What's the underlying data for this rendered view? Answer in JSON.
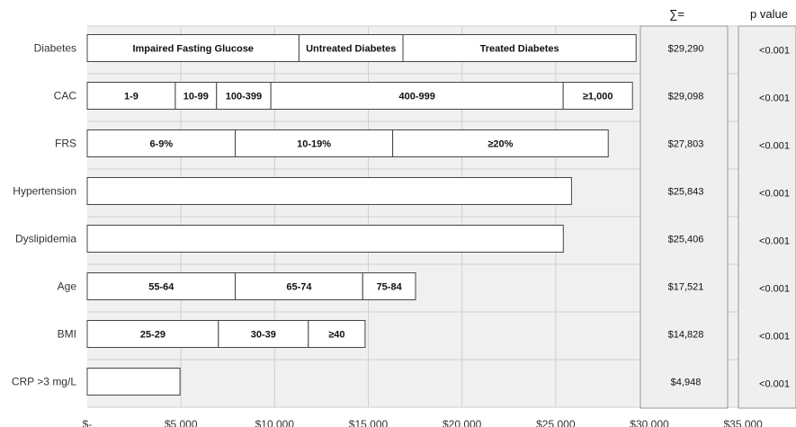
{
  "chart_data": {
    "type": "bar",
    "orientation": "horizontal",
    "stacked_segments": true,
    "xlim": [
      0,
      35000
    ],
    "grid": true,
    "x_ticks": [
      {
        "value": 0,
        "label": "$-"
      },
      {
        "value": 5000,
        "label": "$5,000"
      },
      {
        "value": 10000,
        "label": "$10,000"
      },
      {
        "value": 15000,
        "label": "$15,000"
      },
      {
        "value": 20000,
        "label": "$20,000"
      },
      {
        "value": 25000,
        "label": "$25,000"
      },
      {
        "value": 30000,
        "label": "$30,000"
      },
      {
        "value": 35000,
        "label": "$35,000"
      }
    ],
    "column_headers": {
      "sum": "∑=",
      "p": "p value"
    },
    "rows": [
      {
        "label": "Diabetes",
        "total": 29290,
        "sum_label": "$29,290",
        "p": "<0.001",
        "segments": [
          {
            "label": "Impaired Fasting Glucose",
            "start": 0,
            "end": 11300
          },
          {
            "label": "Untreated Diabetes",
            "start": 11300,
            "end": 16850
          },
          {
            "label": "Treated Diabetes",
            "start": 16850,
            "end": 29290
          }
        ]
      },
      {
        "label": "CAC",
        "total": 29098,
        "sum_label": "$29,098",
        "p": "<0.001",
        "segments": [
          {
            "label": "1-9",
            "start": 0,
            "end": 4700
          },
          {
            "label": "10-99",
            "start": 4700,
            "end": 6900
          },
          {
            "label": "100-399",
            "start": 6900,
            "end": 9800
          },
          {
            "label": "400-999",
            "start": 9800,
            "end": 25400
          },
          {
            "label": "≥1,000",
            "start": 25400,
            "end": 29098
          }
        ]
      },
      {
        "label": "FRS",
        "total": 27803,
        "sum_label": "$27,803",
        "p": "<0.001",
        "segments": [
          {
            "label": "6-9%",
            "start": 0,
            "end": 7900
          },
          {
            "label": "10-19%",
            "start": 7900,
            "end": 16300
          },
          {
            "label": "≥20%",
            "start": 16300,
            "end": 27803
          }
        ]
      },
      {
        "label": "Hypertension",
        "total": 25843,
        "sum_label": "$25,843",
        "p": "<0.001",
        "segments": [
          {
            "label": "",
            "start": 0,
            "end": 25843
          }
        ]
      },
      {
        "label": "Dyslipidemia",
        "total": 25406,
        "sum_label": "$25,406",
        "p": "<0.001",
        "segments": [
          {
            "label": "",
            "start": 0,
            "end": 25406
          }
        ]
      },
      {
        "label": "Age",
        "total": 17521,
        "sum_label": "$17,521",
        "p": "<0.001",
        "segments": [
          {
            "label": "55-64",
            "start": 0,
            "end": 7900
          },
          {
            "label": "65-74",
            "start": 7900,
            "end": 14700
          },
          {
            "label": "75-84",
            "start": 14700,
            "end": 17521
          }
        ]
      },
      {
        "label": "BMI",
        "total": 14828,
        "sum_label": "$14,828",
        "p": "<0.001",
        "segments": [
          {
            "label": "25-29",
            "start": 0,
            "end": 7000
          },
          {
            "label": "30-39",
            "start": 7000,
            "end": 11800
          },
          {
            "label": "≥40",
            "start": 11800,
            "end": 14828
          }
        ]
      },
      {
        "label": "CRP >3 mg/L",
        "total": 4948,
        "sum_label": "$4,948",
        "p": "<0.001",
        "segments": [
          {
            "label": "",
            "start": 0,
            "end": 4948
          }
        ]
      }
    ],
    "colors": {
      "background": "#f0f0f0",
      "bar_fill": "#ffffff",
      "stroke": "#444444",
      "grid": "#cfcfcf"
    }
  }
}
